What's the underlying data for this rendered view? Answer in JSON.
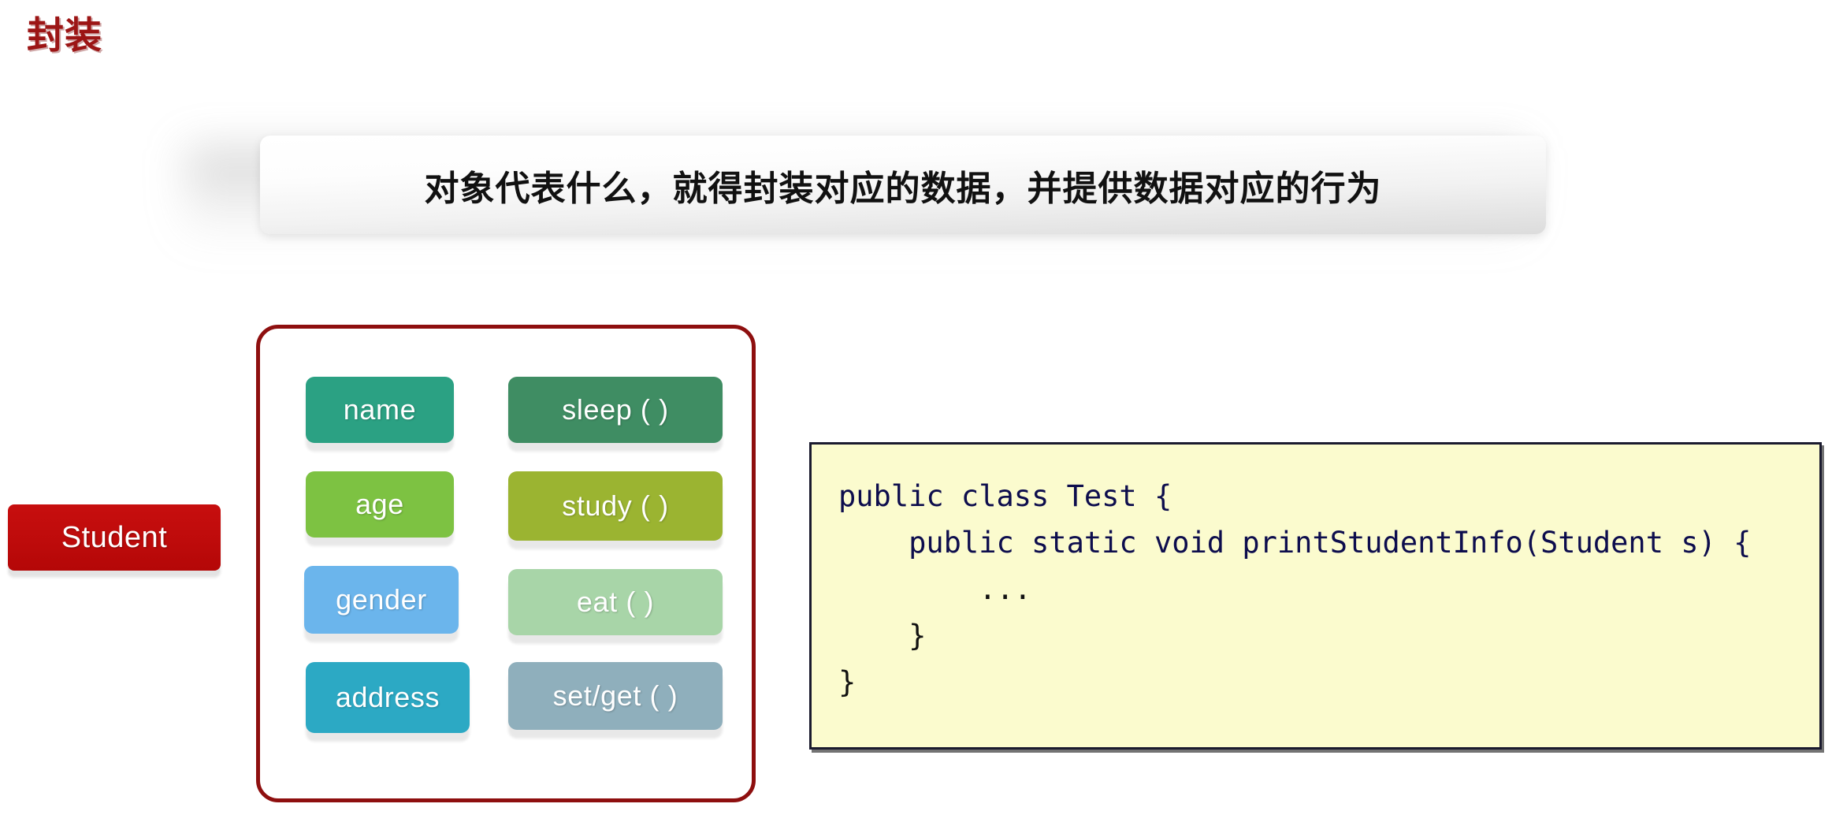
{
  "slide": {
    "title": "封装",
    "title_color": "#9C1515"
  },
  "banner": {
    "text": "对象代表什么，就得封装对应的数据，并提供数据对应的行为"
  },
  "class_tag": {
    "label": "Student",
    "color": "#C00000"
  },
  "class_box": {
    "border_color": "#8E0F0F",
    "fields": [
      {
        "label": "name",
        "color": "#2BA183"
      },
      {
        "label": "age",
        "color": "#7DC242"
      },
      {
        "label": "gender",
        "color": "#6BB5EC"
      },
      {
        "label": "address",
        "color": "#2CA9C4"
      }
    ],
    "methods": [
      {
        "label": "sleep ( )",
        "color": "#3F8D63"
      },
      {
        "label": "study ( )",
        "color": "#9BB431"
      },
      {
        "label": "eat ( )",
        "color": "#A8D5A8"
      },
      {
        "label": "set/get ( )",
        "color": "#8FAFBC"
      }
    ]
  },
  "code_panel": {
    "background": "#FBFBCE",
    "border_color": "#1A1A2E",
    "keyword_color": "#0D0D4D",
    "lines": [
      "public class Test {",
      "    public static void printStudentInfo(Student s) {",
      "        ...",
      "    }",
      "}"
    ],
    "text": "public class Test {\n    public static void printStudentInfo(Student s) {\n        ...\n    }\n}"
  }
}
